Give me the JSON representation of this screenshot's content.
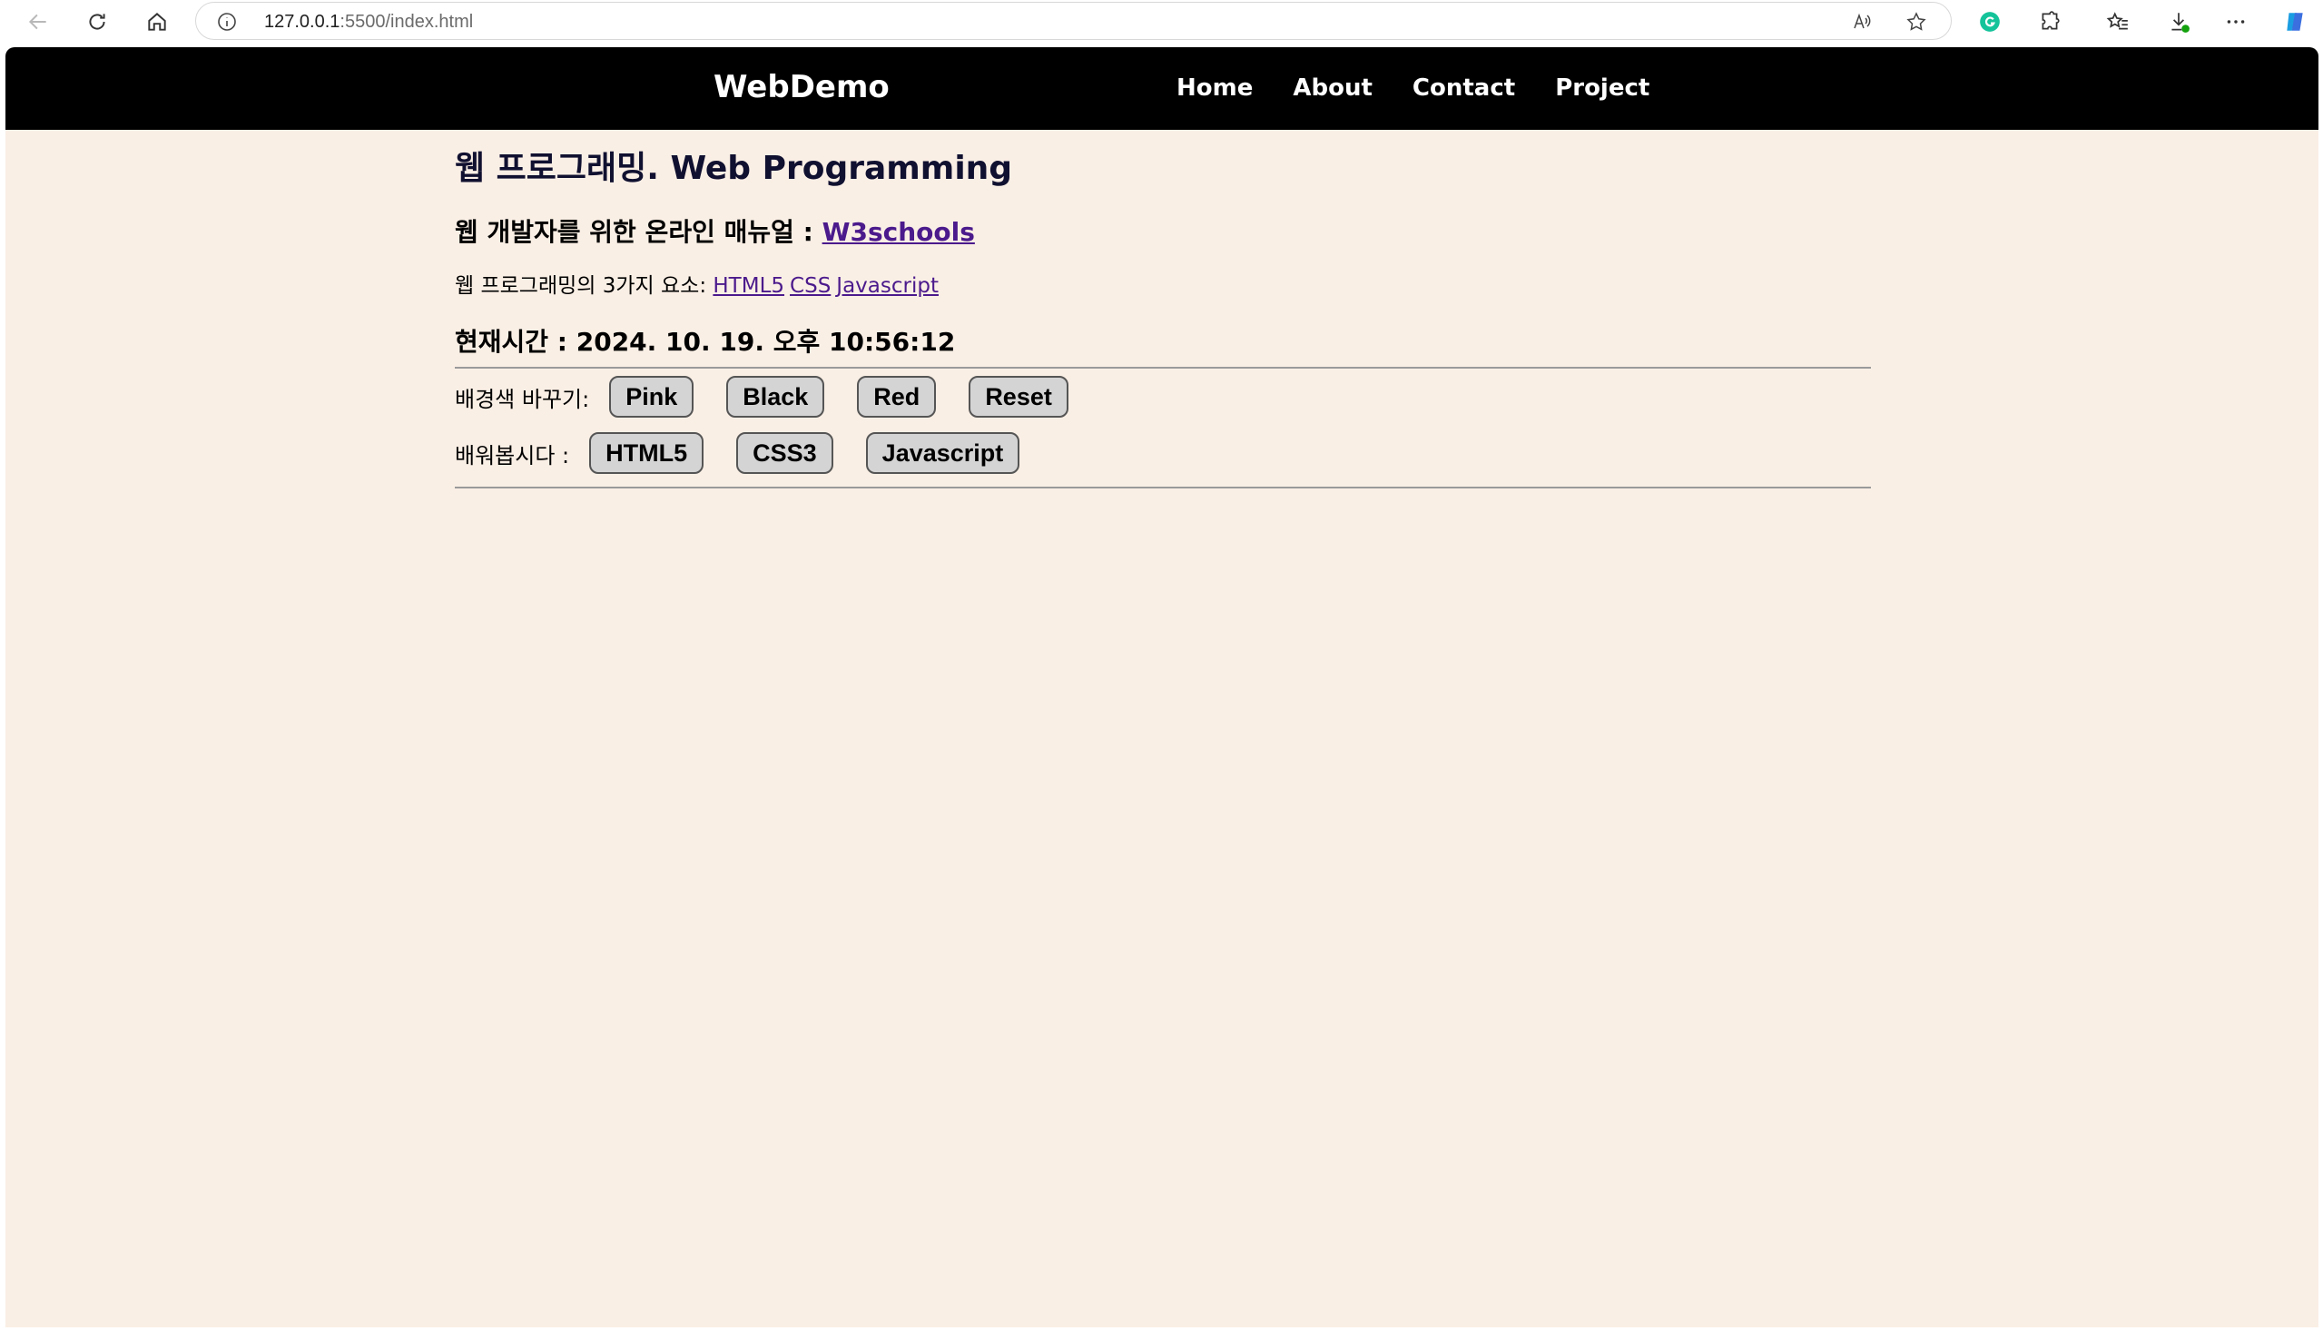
{
  "browser": {
    "url_host": "127.0.0.1",
    "url_rest": ":5500/index.html"
  },
  "navbar": {
    "brand": "WebDemo",
    "links": [
      "Home",
      "About",
      "Contact",
      "Project"
    ]
  },
  "main": {
    "title": "웹 프로그래밍. Web Programming",
    "subtitle_prefix": "웹 개발자를 위한 온라인 매뉴얼 : ",
    "subtitle_link": "W3schools",
    "elements_label": "웹 프로그래밍의 3가지 요소: ",
    "element_links": [
      "HTML5",
      "CSS",
      "Javascript"
    ],
    "clock_label": "현재시간 : ",
    "clock_value": "2024. 10. 19. 오후 10:56:12",
    "bg_label": "배경색 바꾸기:",
    "bg_buttons": [
      "Pink",
      "Black",
      "Red",
      "Reset"
    ],
    "learn_label": "배워봅시다 :",
    "learn_buttons": [
      "HTML5",
      "CSS3",
      "Javascript"
    ]
  }
}
